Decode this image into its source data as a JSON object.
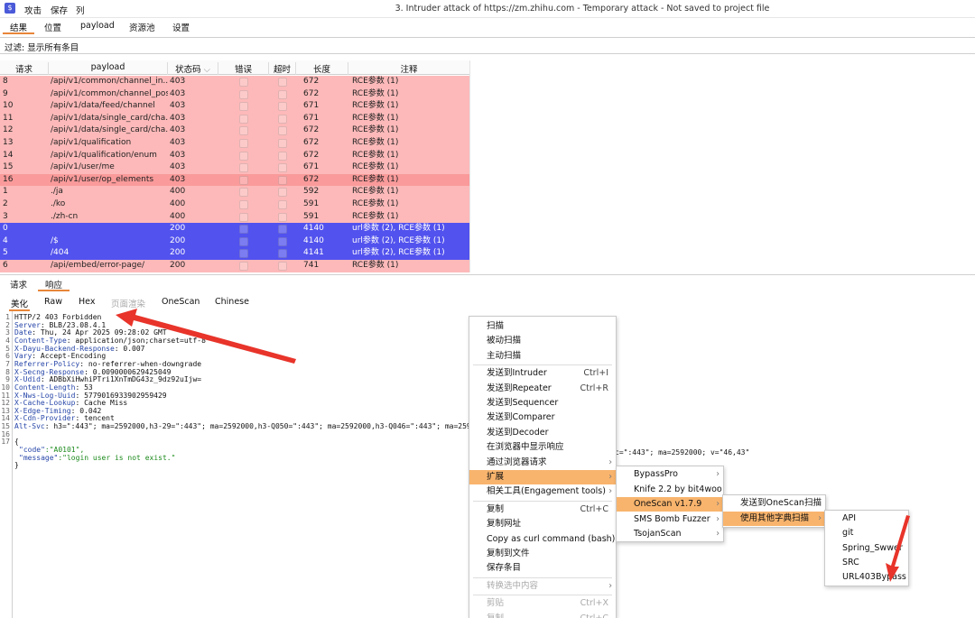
{
  "logo": "$",
  "top_menu": [
    "攻击",
    "保存",
    "列"
  ],
  "window_title": "3. Intruder attack of https://zm.zhihu.com - Temporary attack - Not saved to project file",
  "tabs": [
    "结果",
    "位置",
    "payload",
    "资源池",
    "设置"
  ],
  "filter": "过滤: 显示所有条目",
  "table": {
    "headers": [
      "请求",
      "payload",
      "状态码",
      "错误",
      "超时",
      "长度",
      "注释"
    ],
    "sort_indicator": "⌵",
    "rows": [
      {
        "req": "8",
        "payload": "/api/v1/common/channel_in...",
        "status": "403",
        "length": "672",
        "comment": "RCE参数 (1)",
        "style": "pink"
      },
      {
        "req": "9",
        "payload": "/api/v1/common/channel_pos",
        "status": "403",
        "length": "672",
        "comment": "RCE参数 (1)",
        "style": "pink"
      },
      {
        "req": "10",
        "payload": "/api/v1/data/feed/channel",
        "status": "403",
        "length": "671",
        "comment": "RCE参数 (1)",
        "style": "pink"
      },
      {
        "req": "11",
        "payload": "/api/v1/data/single_card/cha...",
        "status": "403",
        "length": "671",
        "comment": "RCE参数 (1)",
        "style": "pink"
      },
      {
        "req": "12",
        "payload": "/api/v1/data/single_card/cha...",
        "status": "403",
        "length": "672",
        "comment": "RCE参数 (1)",
        "style": "pink"
      },
      {
        "req": "13",
        "payload": "/api/v1/qualification",
        "status": "403",
        "length": "672",
        "comment": "RCE参数 (1)",
        "style": "pink"
      },
      {
        "req": "14",
        "payload": "/api/v1/qualification/enum",
        "status": "403",
        "length": "672",
        "comment": "RCE参数 (1)",
        "style": "pink"
      },
      {
        "req": "15",
        "payload": "/api/v1/user/me",
        "status": "403",
        "length": "671",
        "comment": "RCE参数 (1)",
        "style": "pink"
      },
      {
        "req": "16",
        "payload": "/api/v1/user/op_elements",
        "status": "403",
        "length": "672",
        "comment": "RCE参数 (1)",
        "style": "sel"
      },
      {
        "req": "1",
        "payload": "./ja",
        "status": "400",
        "length": "592",
        "comment": "RCE参数 (1)",
        "style": "pink"
      },
      {
        "req": "2",
        "payload": "./ko",
        "status": "400",
        "length": "591",
        "comment": "RCE参数 (1)",
        "style": "pink"
      },
      {
        "req": "3",
        "payload": "./zh-cn",
        "status": "400",
        "length": "591",
        "comment": "RCE参数 (1)",
        "style": "pink"
      },
      {
        "req": "0",
        "payload": "",
        "status": "200",
        "length": "4140",
        "comment": "url参数 (2), RCE参数 (1)",
        "style": "blue"
      },
      {
        "req": "4",
        "payload": "/$",
        "status": "200",
        "length": "4140",
        "comment": "url参数 (2), RCE参数 (1)",
        "style": "blue"
      },
      {
        "req": "5",
        "payload": "/404",
        "status": "200",
        "length": "4141",
        "comment": "url参数 (2), RCE参数 (1)",
        "style": "blue"
      },
      {
        "req": "6",
        "payload": "/api/embed/error-page/",
        "status": "200",
        "length": "741",
        "comment": "RCE参数 (1)",
        "style": "pink"
      }
    ]
  },
  "reqresp_tabs": [
    "请求",
    "响应"
  ],
  "view_tabs": [
    "美化",
    "Raw",
    "Hex",
    "页面渲染",
    "OneScan",
    "Chinese"
  ],
  "response_lines": [
    {
      "n": "1",
      "key": "",
      "val": "HTTP/2 403 Forbidden"
    },
    {
      "n": "2",
      "key": "Server",
      "val": ": BLB/23.08.4.1"
    },
    {
      "n": "3",
      "key": "Date",
      "val": ": Thu, 24 Apr 2025 09:28:02 GMT"
    },
    {
      "n": "4",
      "key": "Content-Type",
      "val": ": application/json;charset=utf-8"
    },
    {
      "n": "5",
      "key": "X-Dayu-Backend-Response",
      "val": ": 0.007"
    },
    {
      "n": "6",
      "key": "Vary",
      "val": ": Accept-Encoding"
    },
    {
      "n": "7",
      "key": "Referrer-Policy",
      "val": ": no-referrer-when-downgrade"
    },
    {
      "n": "8",
      "key": "X-Secng-Response",
      "val": ": 0.0090000629425049"
    },
    {
      "n": "9",
      "key": "X-Udid",
      "val": ": ADBbXiHwhiPTri1XnTmDG43z_9dz92uIjw="
    },
    {
      "n": "10",
      "key": "Content-Length",
      "val": ": 53"
    },
    {
      "n": "11",
      "key": "X-Nws-Log-Uuid",
      "val": ": 577901693390295942​9"
    },
    {
      "n": "12",
      "key": "X-Cache-Lookup",
      "val": ": Cache Miss"
    },
    {
      "n": "13",
      "key": "X-Edge-Timing",
      "val": ": 0.042"
    },
    {
      "n": "14",
      "key": "X-Cdn-Provider",
      "val": ": tencent"
    },
    {
      "n": "15",
      "key": "Alt-Svc",
      "val": ": h3=\":443\"; ma=2592000,h3-29=\":443\"; ma=2592000,h3-Q050=\":443\"; ma=2592000,h3-Q046=\":443\"; ma=2592"
    },
    {
      "n": "16",
      "key": "",
      "val": ""
    },
    {
      "n": "17",
      "key": "",
      "val": "{"
    },
    {
      "n": "",
      "key": "\"code\"",
      "val": ":\"A0101\","
    },
    {
      "n": "",
      "key": "\"message\"",
      "val": ":\"login user is not exist.\""
    },
    {
      "n": "",
      "key": "",
      "val": "}"
    }
  ],
  "alt_svc_tail": "c=\":443\"; ma=2592000; v=\"46,43\"",
  "context_menu": [
    {
      "label": "扫描"
    },
    {
      "label": "被动扫描"
    },
    {
      "label": "主动扫描"
    },
    {
      "sep": true
    },
    {
      "label": "发送到Intruder",
      "shortcut": "Ctrl+I"
    },
    {
      "label": "发送到Repeater",
      "shortcut": "Ctrl+R"
    },
    {
      "label": "发送到Sequencer"
    },
    {
      "label": "发送到Comparer"
    },
    {
      "label": "发送到Decoder"
    },
    {
      "label": "在浏览器中显示响应"
    },
    {
      "label": "通过浏览器请求",
      "arrow": true
    },
    {
      "label": "扩展",
      "arrow": true,
      "hl": true
    },
    {
      "label": "相关工具(Engagement tools)",
      "arrow": true
    },
    {
      "sep": true
    },
    {
      "label": "复制",
      "shortcut": "Ctrl+C"
    },
    {
      "label": "复制网址"
    },
    {
      "label": "Copy as curl command (bash)"
    },
    {
      "label": "复制到文件"
    },
    {
      "label": "保存条目"
    },
    {
      "sep": true
    },
    {
      "label": "转换选中内容",
      "arrow": true,
      "dis": true
    },
    {
      "sep": true
    },
    {
      "label": "剪贴",
      "shortcut": "Ctrl+X",
      "dis": true
    },
    {
      "label": "复制",
      "shortcut": "Ctrl+C",
      "dis": true
    }
  ],
  "ext_menu": [
    {
      "label": "BypassPro",
      "arrow": true
    },
    {
      "label": "Knife 2.2 by bit4woo",
      "arrow": true
    },
    {
      "label": "OneScan v1.7.9",
      "arrow": true,
      "hl": true
    },
    {
      "label": "SMS Bomb Fuzzer",
      "arrow": true
    },
    {
      "label": "TsojanScan",
      "arrow": true
    }
  ],
  "onescan_menu": [
    {
      "label": "发送到OneScan扫描"
    },
    {
      "label": "使用其他字典扫描",
      "arrow": true,
      "hl": true
    }
  ],
  "dict_menu": [
    "API",
    "git",
    "Spring_Swwer",
    "SRC",
    "URL403Bypass"
  ],
  "colors": {
    "pink": "#fdb9b9",
    "selected": "#fa9a9a",
    "blue": "#5252ee",
    "menu_highlight": "#f8b46d",
    "arrow": "#e8342a",
    "tab_accent": "#e8863a"
  }
}
